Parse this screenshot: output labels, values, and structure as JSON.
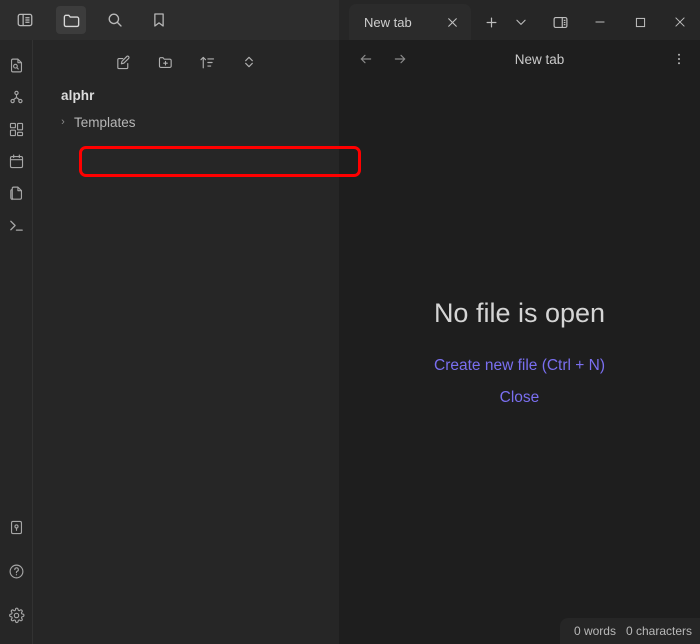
{
  "app": {
    "vault_name": "alphr",
    "theme_bg": "#1e1e1e",
    "panel_bg": "#262626",
    "accent_link": "#7a6ff0",
    "annotation_color": "#ff0000"
  },
  "left_top_bar": {
    "buttons": [
      {
        "label": "Toggle sidebar",
        "icon": "sidebar-toggle-icon",
        "active": false
      },
      {
        "label": "Files",
        "icon": "folder-icon",
        "active": true
      },
      {
        "label": "Search",
        "icon": "search-icon",
        "active": false
      },
      {
        "label": "Bookmarks",
        "icon": "bookmark-icon",
        "active": false
      }
    ]
  },
  "icon_rail": {
    "top_items": [
      {
        "label": "File properties",
        "icon": "file-search-icon"
      },
      {
        "label": "Graph view",
        "icon": "graph-icon"
      },
      {
        "label": "Canvas",
        "icon": "canvas-grid-icon"
      },
      {
        "label": "Daily notes",
        "icon": "calendar-icon"
      },
      {
        "label": "Templates",
        "icon": "copy-pages-icon"
      },
      {
        "label": "Terminal",
        "icon": "terminal-icon"
      }
    ],
    "bottom_items": [
      {
        "label": "Vault",
        "icon": "vault-key-icon"
      },
      {
        "label": "Help",
        "icon": "help-circle-icon"
      },
      {
        "label": "Settings",
        "icon": "gear-icon"
      }
    ]
  },
  "files_panel": {
    "toolbar": [
      {
        "label": "New note",
        "icon": "new-note-pencil-icon"
      },
      {
        "label": "New folder",
        "icon": "new-folder-icon"
      },
      {
        "label": "Change sort order",
        "icon": "sort-icon"
      },
      {
        "label": "Expand or collapse all",
        "icon": "collapse-expand-icon"
      }
    ],
    "vault_label": "alphr",
    "tree": [
      {
        "label": "Templates",
        "type": "folder",
        "expanded": false,
        "chevron": "›",
        "highlighted": true
      }
    ]
  },
  "annotation": {
    "target": "Templates",
    "shape": "rounded-rectangle",
    "color": "#ff0000"
  },
  "editor": {
    "tabs": [
      {
        "title": "New tab",
        "active": true,
        "close_icon": "close-icon"
      }
    ],
    "tab_controls": [
      {
        "label": "New tab",
        "icon": "plus-icon"
      },
      {
        "label": "Tab list",
        "icon": "chevron-down-icon"
      }
    ],
    "window_controls": [
      {
        "label": "Toggle right sidebar",
        "icon": "right-sidebar-toggle-icon"
      },
      {
        "label": "Minimize",
        "icon": "minimize-icon"
      },
      {
        "label": "Maximize",
        "icon": "maximize-icon"
      },
      {
        "label": "Close",
        "icon": "close-icon"
      }
    ],
    "navbar": {
      "back_icon": "arrow-left-icon",
      "forward_icon": "arrow-right-icon",
      "title": "New tab",
      "more_icon": "more-vertical-icon"
    },
    "empty_state": {
      "title": "No file is open",
      "create_link": "Create new file (Ctrl + N)",
      "close_link": "Close"
    }
  },
  "status_bar": {
    "words": "0 words",
    "characters": "0 characters"
  }
}
